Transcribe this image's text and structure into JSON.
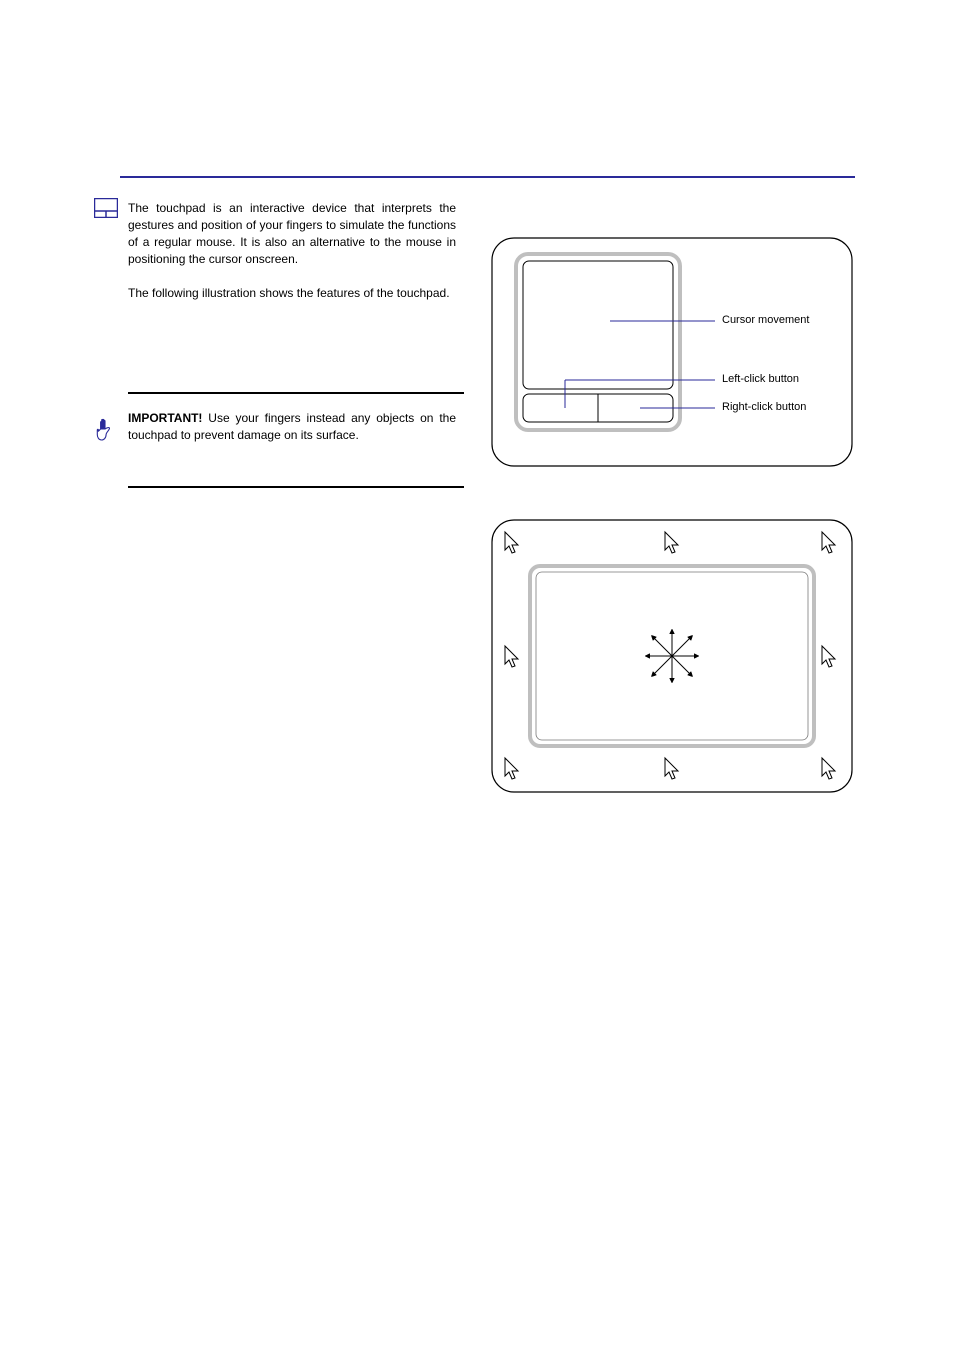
{
  "intro": "The touchpad is an interactive device that interprets the gestures and position of your fingers to simulate the functions of a regular mouse. It is also an alternative to the mouse in positioning the cursor onscreen.\n\nThe following illustration shows the features of the touchpad.",
  "important": {
    "label": "IMPORTANT!",
    "text": " Use your fingers instead any objects on the touchpad to prevent damage on its surface."
  },
  "figure1": {
    "movement": "Cursor movement",
    "left": "Left-click button",
    "right": "Right-click button"
  }
}
